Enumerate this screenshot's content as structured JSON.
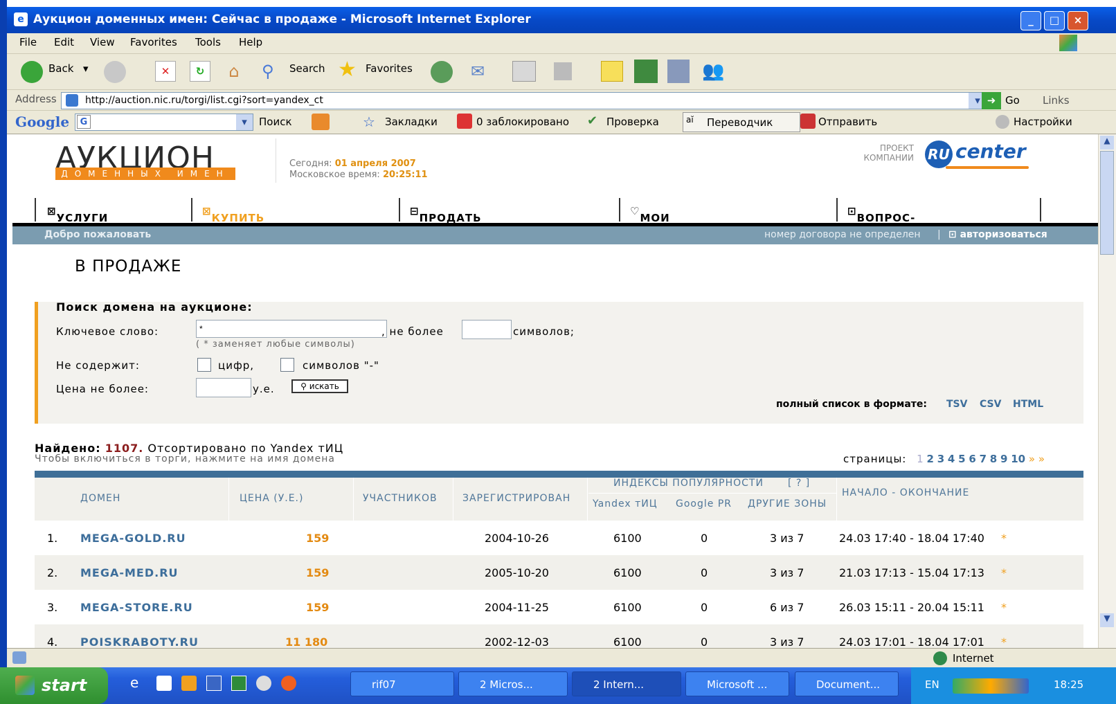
{
  "window": {
    "title": "Аукцион доменных имен: Сейчас в продаже - Microsoft Internet Explorer"
  },
  "menu": [
    "File",
    "Edit",
    "View",
    "Favorites",
    "Tools",
    "Help"
  ],
  "toolbar": {
    "back": "Back",
    "search": "Search",
    "favorites": "Favorites"
  },
  "address": {
    "label": "Address",
    "url": "http://auction.nic.ru/torgi/list.cgi?sort=yandex_ct",
    "go": "Go",
    "links": "Links"
  },
  "google_bar": {
    "logo": "Google",
    "search": "Поиск",
    "bookmarks": "Закладки",
    "blocked": "0 заблокировано",
    "check": "Проверка",
    "translator": "Переводчик",
    "send": "Отправить",
    "settings": "Настройки"
  },
  "header": {
    "logo_main": "АУКЦИОН",
    "logo_sub": "ДОМЕННЫХ ИМЕН",
    "today_label": "Сегодня:",
    "today_value": "01 апреля 2007",
    "time_label": "Московское время:",
    "time_value": "20:25:11",
    "project_label_1": "ПРОЕКТ",
    "project_label_2": "КОМПАНИИ",
    "rucenter": "center",
    "ru": "RU"
  },
  "nav": [
    "УСЛУГИ",
    "КУПИТЬ ДОМЕН",
    "ПРОДАТЬ ДОМЕН",
    "МОИ АУКЦИОНЫ",
    "ВОПРОС-ОТВЕТ"
  ],
  "welcome": {
    "left": "Добро пожаловать",
    "contract": "номер договора не определен",
    "login": "авторизоваться"
  },
  "page_title": "В ПРОДАЖЕ",
  "search": {
    "title": "Поиск домена на аукционе:",
    "keyword_label": "Ключевое слово:",
    "keyword_value": "*",
    "max_label": ", не более",
    "symbols_label": "символов;",
    "hint": "( * заменяет любые символы)",
    "not_contains_label": "Не содержит:",
    "digits_label": "цифр,",
    "dash_label": "символов \"-\"",
    "price_label": "Цена не более:",
    "currency": "у.е.",
    "search_button": "искать",
    "full_list_label": "полный список в формате:",
    "formats": [
      "TSV",
      "CSV",
      "HTML"
    ]
  },
  "results": {
    "found_label": "Найдено:",
    "found_count": "1107.",
    "sorted_label": "Отсортировано по Yandex тИЦ",
    "hint": "Чтобы включиться в торги, нажмите на имя домена",
    "pages_label": "страницы:",
    "pages": [
      "1",
      "2",
      "3",
      "4",
      "5",
      "6",
      "7",
      "8",
      "9",
      "10"
    ],
    "more": "» »"
  },
  "table": {
    "headers": {
      "domain": "ДОМЕН",
      "price": "ЦЕНА (У.Е.)",
      "participants": "УЧАСТНИКОВ",
      "registered": "ЗАРЕГИСТРИРОВАН",
      "popularity": "ИНДЕКСЫ ПОПУЛЯРНОСТИ",
      "help": "[ ? ]",
      "yandex": "Yandex тИЦ",
      "google": "Google PR",
      "zones": "ДРУГИЕ ЗОНЫ",
      "period": "НАЧАЛО - ОКОНЧАНИЕ"
    },
    "rows": [
      {
        "n": "1.",
        "domain": "MEGA-GOLD.RU",
        "price": "159",
        "participants": "",
        "registered": "2004-10-26",
        "yandex": "6100",
        "google": "0",
        "zones": "3 из 7",
        "period": "24.03 17:40 - 18.04 17:40",
        "mark": "*"
      },
      {
        "n": "2.",
        "domain": "MEGA-MED.RU",
        "price": "159",
        "participants": "",
        "registered": "2005-10-20",
        "yandex": "6100",
        "google": "0",
        "zones": "3 из 7",
        "period": "21.03 17:13 - 15.04 17:13",
        "mark": "*"
      },
      {
        "n": "3.",
        "domain": "MEGA-STORE.RU",
        "price": "159",
        "participants": "",
        "registered": "2004-11-25",
        "yandex": "6100",
        "google": "0",
        "zones": "6 из 7",
        "period": "26.03 15:11 - 20.04 15:11",
        "mark": "*"
      },
      {
        "n": "4.",
        "domain": "POISKRABOTY.RU",
        "price": "11 180",
        "participants": "",
        "registered": "2002-12-03",
        "yandex": "6100",
        "google": "0",
        "zones": "3 из 7",
        "period": "24.03 17:01 - 18.04 17:01",
        "mark": "*"
      }
    ]
  },
  "status": {
    "zone": "Internet"
  },
  "taskbar": {
    "start": "start",
    "tasks": [
      "rif07",
      "2 Micros...",
      "2 Intern...",
      "Microsoft ...",
      "Document..."
    ],
    "lang": "EN",
    "clock": "18:25"
  },
  "colors": {
    "accent": "#f08a1c",
    "link": "#3d6e9b",
    "bar": "#7b9cb0",
    "xp_blue": "#0a5fe8"
  }
}
